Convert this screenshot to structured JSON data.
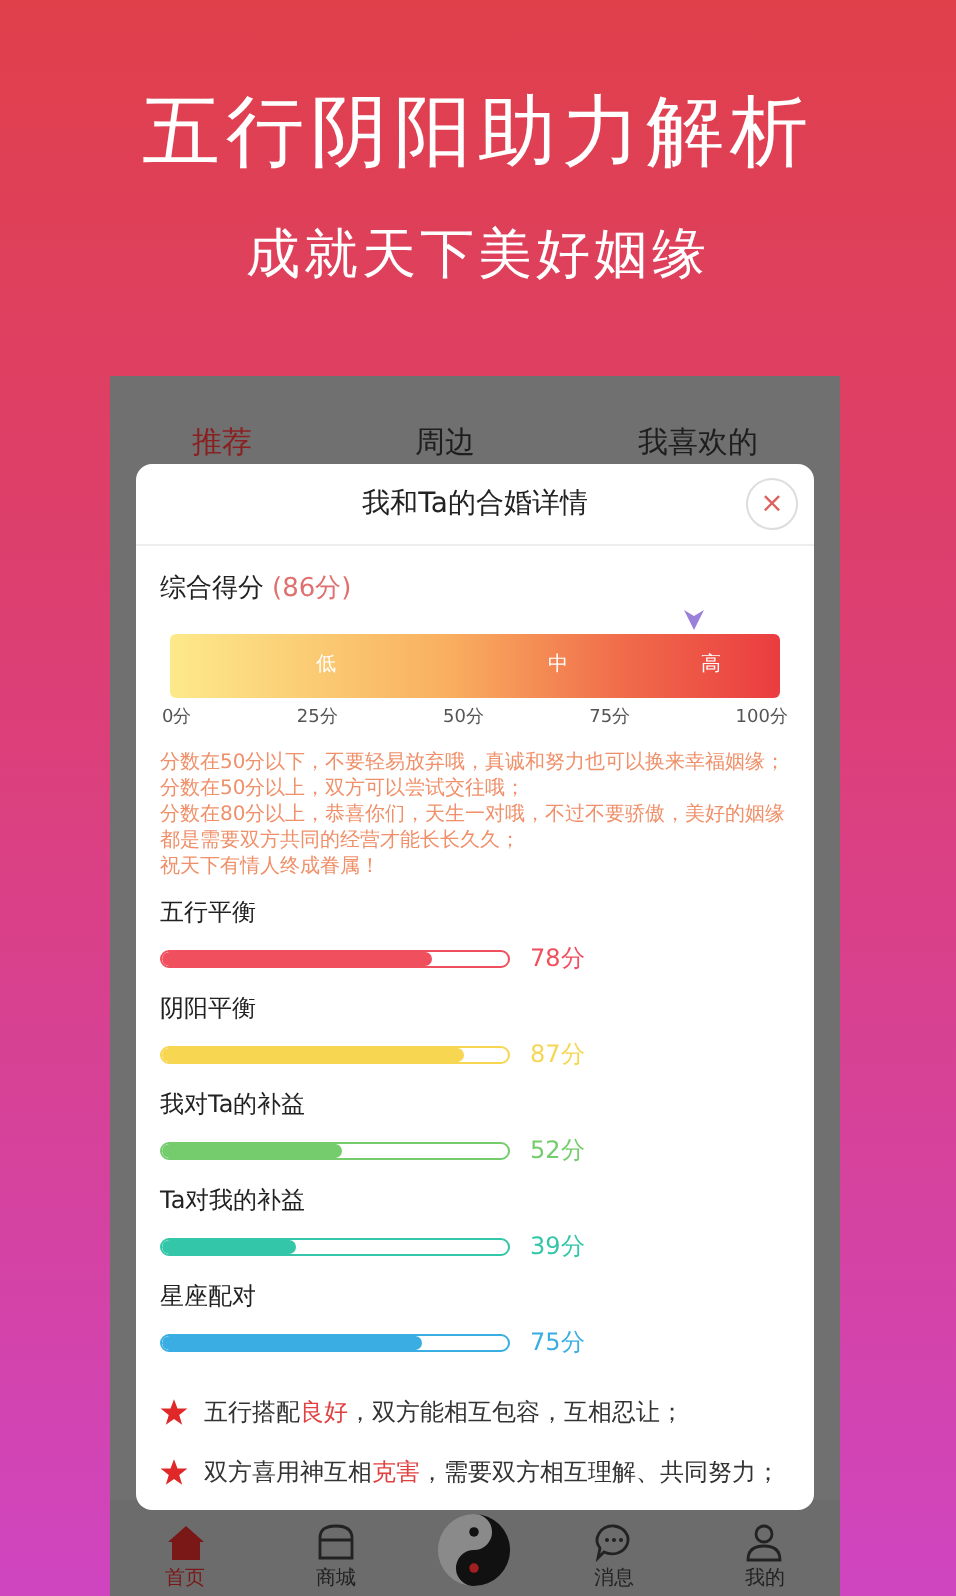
{
  "headline": "五行阴阳助力解析",
  "subheadline": "成就天下美好姻缘",
  "top_tabs": [
    {
      "label": "推荐",
      "selected": true
    },
    {
      "label": "周边",
      "selected": false
    },
    {
      "label": "我喜欢的",
      "selected": false
    }
  ],
  "dialog": {
    "title": "我和Ta的合婚详情",
    "close": "×",
    "overall": {
      "label": "综合得分",
      "score": "(86分)",
      "level": 0.86,
      "zones": [
        "低",
        "中",
        "高"
      ],
      "ticks": [
        "0分",
        "25分",
        "50分",
        "75分",
        "100分"
      ]
    },
    "notes": [
      "分数在50分以下，不要轻易放弃哦，真诚和努力也可以换来幸福姻缘；",
      "分数在50分以上，双方可以尝试交往哦；",
      "分数在80分以上，恭喜你们，天生一对哦，不过不要骄傲，美好的姻缘",
      "都是需要双方共同的经营才能长长久久；",
      "祝天下有情人终成眷属！"
    ],
    "metrics": [
      {
        "label": "五行平衡",
        "level": 0.78,
        "reading": "78分",
        "color": "#f0505e"
      },
      {
        "label": "阴阳平衡",
        "level": 0.87,
        "reading": "87分",
        "color": "#f7d652"
      },
      {
        "label": "我对Ta的补益",
        "level": 0.52,
        "reading": "52分",
        "color": "#74cc6c"
      },
      {
        "label": "Ta对我的补益",
        "level": 0.39,
        "reading": "39分",
        "color": "#33c6a8"
      },
      {
        "label": "星座配对",
        "level": 0.75,
        "reading": "75分",
        "color": "#3aaee2"
      }
    ],
    "remarks": [
      "五行搭配**良好**，双方能相互包容，互相忍让；",
      "双方喜用神互相**克害**，需要双方相互理解、共同努力；"
    ]
  },
  "bottom_tabs": [
    {
      "label": "首页",
      "kind": "home",
      "selected": true
    },
    {
      "label": "商城",
      "kind": "shop",
      "selected": false
    },
    {
      "label": "消息",
      "kind": "chat",
      "selected": false
    },
    {
      "label": "我的",
      "kind": "person",
      "selected": false
    }
  ]
}
